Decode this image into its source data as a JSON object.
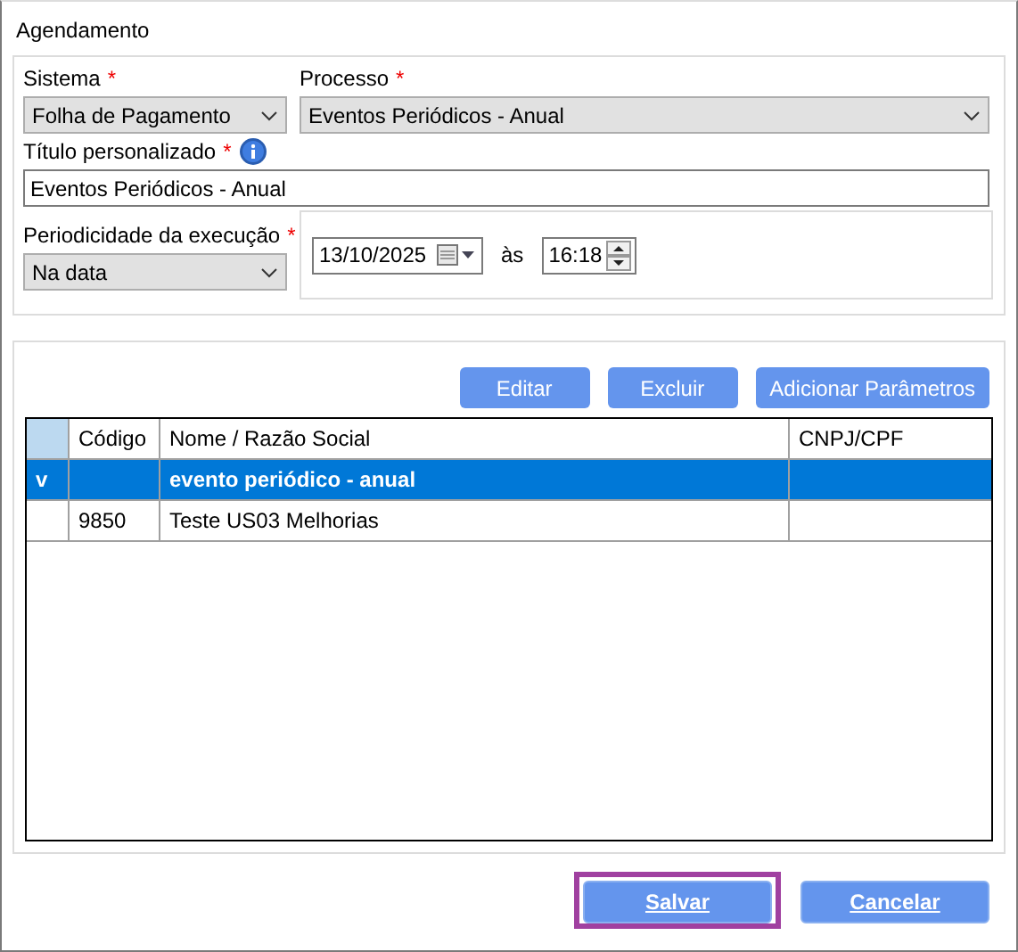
{
  "window": {
    "title": "Agendamento"
  },
  "sistema": {
    "label": "Sistema",
    "required_mark": "*",
    "value": "Folha de Pagamento"
  },
  "processo": {
    "label": "Processo",
    "required_mark": "*",
    "value": "Eventos Periódicos - Anual"
  },
  "titulo": {
    "label": "Título personalizado",
    "required_mark": "*",
    "value": "Eventos Periódicos - Anual"
  },
  "periodicidade": {
    "label": "Periodicidade da execução",
    "required_mark": "*",
    "value": "Na data"
  },
  "date": {
    "value": "13/10/2025"
  },
  "time_separator": "às",
  "time": {
    "value": "16:18"
  },
  "actions": [
    "Editar",
    "Excluir",
    "Adicionar Parâmetros"
  ],
  "table": {
    "columns": [
      "Código",
      "Nome / Razão Social",
      "CNPJ/CPF"
    ],
    "rows": [
      {
        "kind": "group",
        "expander": "v",
        "selected": true,
        "cells": [
          "",
          "evento periódico - anual",
          ""
        ]
      },
      {
        "kind": "item",
        "selected": false,
        "cells": [
          "9850",
          "Teste US03 Melhorias",
          ""
        ]
      }
    ]
  },
  "buttons": [
    {
      "label": "Salvar",
      "focused": true
    },
    {
      "label": "Cancelar",
      "focused": false
    }
  ]
}
